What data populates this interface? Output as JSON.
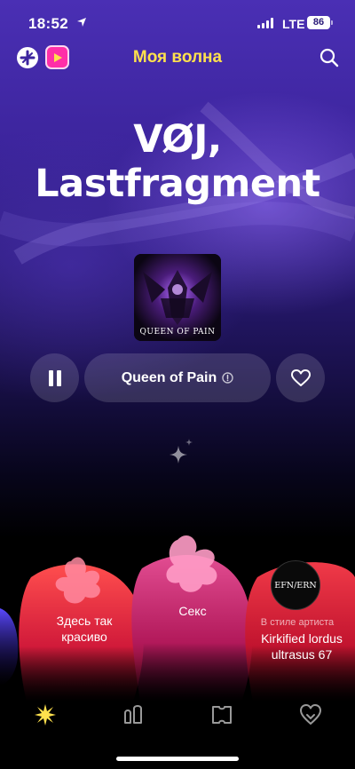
{
  "status_bar": {
    "time": "18:52",
    "network": "LTE",
    "battery": "86"
  },
  "header": {
    "title": "Моя волна"
  },
  "hero": {
    "line1": "VØJ,",
    "line2": "Lastfragment"
  },
  "cover": {
    "text": "QUEEN OF PAIN"
  },
  "player": {
    "track_title": "Queen of Pain"
  },
  "moods": [
    {
      "label_line1": "Здесь так",
      "label_line2": "красиво"
    },
    {
      "label": "Секс"
    },
    {
      "avatar_text": "EFN/ERN",
      "subtitle": "В стиле артиста",
      "label_line1": "Kirkified lordus",
      "label_line2": "ultrasus 67"
    }
  ],
  "colors": {
    "accent_yellow": "#ffe14d",
    "blob_red": "#e8253b",
    "blob_pink": "#e0447e",
    "app_pink": "#ff2fa8"
  }
}
